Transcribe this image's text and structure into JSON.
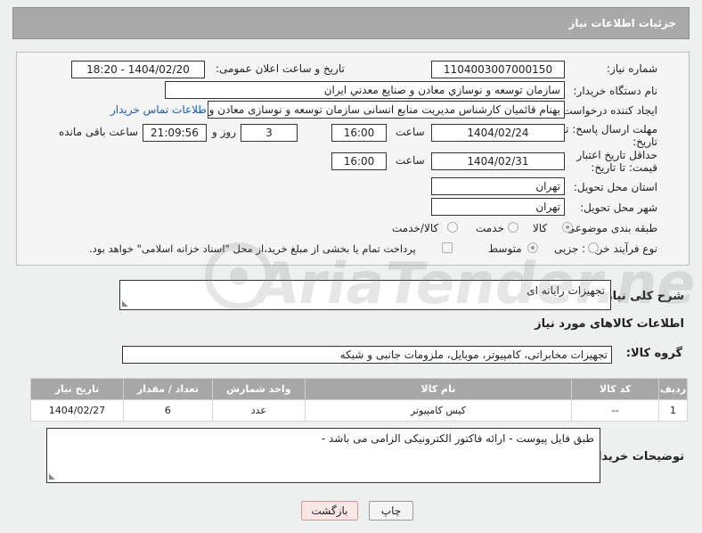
{
  "header": {
    "title": "جزئیات اطلاعات نیاز"
  },
  "form": {
    "need_number_label": "شماره نیاز:",
    "need_number": "1104003007000150",
    "announce_label": "تاریخ و ساعت اعلان عمومی:",
    "announce_value": "1404/02/20 - 18:20",
    "buyer_label": "نام دستگاه خریدار:",
    "buyer_value": "سازمان توسعه و نوسازي معادن و صنايع معدني ايران",
    "creator_label": "ایجاد کننده درخواست:",
    "creator_value": "بهنام قائمیان کارشناس مدیریت منابع انسانی سازمان توسعه و نوسازی معادن و",
    "contact_link": "اطلاعات تماس خریدار",
    "deadline_label": "مهلت ارسال پاسخ: تا تاریخ:",
    "deadline_date": "1404/02/24",
    "time_label": "ساعت",
    "deadline_time": "16:00",
    "days_value": "3",
    "days_label": "روز و",
    "remaining_time": "21:09:56",
    "remaining_label": "ساعت باقی مانده",
    "validity_label": "حداقل تاریخ اعتبار قیمت: تا تاریخ:",
    "validity_date": "1404/02/31",
    "validity_time": "16:00",
    "province_label": "استان محل تحویل:",
    "province_value": "تهران",
    "city_label": "شهر محل تحویل:",
    "city_value": "تهران",
    "category_label": "طبقه بندی موضوعی:",
    "category_options": [
      "کالا",
      "خدمت",
      "کالا/خدمت"
    ],
    "category_selected": "کالا",
    "process_label": "نوع فرآیند خرید :",
    "process_options": [
      "جزیی",
      "متوسط"
    ],
    "process_selected": "متوسط",
    "payment_note": "پرداخت تمام یا بخشی از مبلغ خرید،از محل \"اسناد خزانه اسلامی\" خواهد بود."
  },
  "description": {
    "label": "شرح کلی نیاز:",
    "value": "تجهیزات رایانه ای"
  },
  "goods_section": {
    "title": "اطلاعات کالاهای مورد نیاز",
    "group_label": "گروه کالا:",
    "group_value": "تجهیزات مخابراتی، کامپیوتر، موبایل، ملزومات جانبی و شبکه"
  },
  "table": {
    "headers": [
      "ردیف",
      "کد کالا",
      "نام کالا",
      "واحد شمارش",
      "تعداد / مقدار",
      "تاریخ نیاز"
    ],
    "rows": [
      [
        "1",
        "--",
        "کیس کامپیوتر",
        "عدد",
        "6",
        "1404/02/27"
      ]
    ]
  },
  "buyer_notes": {
    "label": "توضیحات خریدار:",
    "value": "طبق فایل پیوست - ارائه فاکتور الکترونیکی الزامی می باشد -"
  },
  "buttons": {
    "print": "چاپ",
    "back": "بازگشت"
  },
  "watermark": {
    "text": "AriaTender.neT"
  }
}
